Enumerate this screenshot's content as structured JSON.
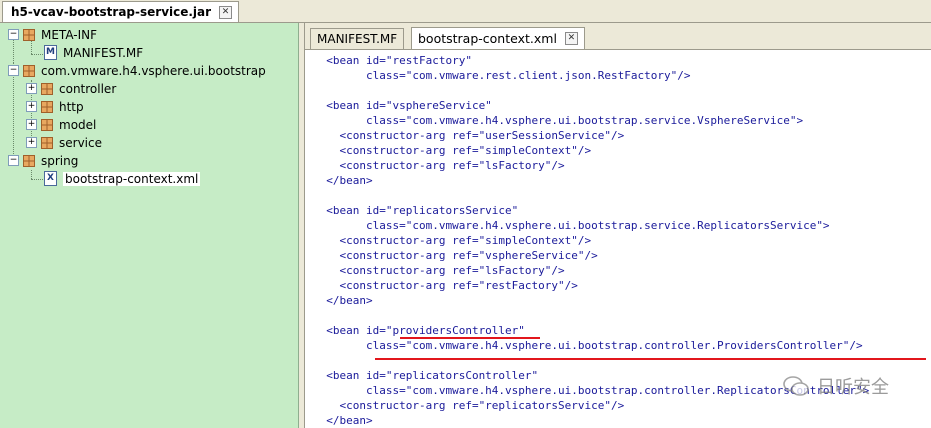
{
  "window": {
    "jar_tab_label": "h5-vcav-bootstrap-service.jar"
  },
  "tree": {
    "items": [
      {
        "label": "META-INF",
        "icon": "package-icon",
        "expander": "-"
      },
      {
        "label": "MANIFEST.MF",
        "icon": "manifest-file-icon",
        "icon_text": "M"
      },
      {
        "label": "com.vmware.h4.vsphere.ui.bootstrap",
        "icon": "package-icon",
        "expander": "-"
      },
      {
        "label": "controller",
        "icon": "package-icon",
        "expander": "+"
      },
      {
        "label": "http",
        "icon": "package-icon",
        "expander": "+"
      },
      {
        "label": "model",
        "icon": "package-icon",
        "expander": "+"
      },
      {
        "label": "service",
        "icon": "package-icon",
        "expander": "+"
      },
      {
        "label": "spring",
        "icon": "package-icon",
        "expander": "-"
      },
      {
        "label": "bootstrap-context.xml",
        "icon": "xml-file-icon",
        "icon_text": "X",
        "selected": true
      }
    ]
  },
  "editor": {
    "tabs": [
      {
        "label": "MANIFEST.MF",
        "active": false
      },
      {
        "label": "bootstrap-context.xml",
        "active": true
      }
    ],
    "lines": [
      "  <bean id=\"restFactory\"",
      "        class=\"com.vmware.rest.client.json.RestFactory\"/>",
      "",
      "  <bean id=\"vsphereService\"",
      "        class=\"com.vmware.h4.vsphere.ui.bootstrap.service.VsphereService\">",
      "    <constructor-arg ref=\"userSessionService\"/>",
      "    <constructor-arg ref=\"simpleContext\"/>",
      "    <constructor-arg ref=\"lsFactory\"/>",
      "  </bean>",
      "",
      "  <bean id=\"replicatorsService\"",
      "        class=\"com.vmware.h4.vsphere.ui.bootstrap.service.ReplicatorsService\">",
      "    <constructor-arg ref=\"simpleContext\"/>",
      "    <constructor-arg ref=\"vsphereService\"/>",
      "    <constructor-arg ref=\"lsFactory\"/>",
      "    <constructor-arg ref=\"restFactory\"/>",
      "  </bean>",
      "",
      "  <bean id=\"providersController\"",
      "        class=\"com.vmware.h4.vsphere.ui.bootstrap.controller.ProvidersController\"/>",
      "",
      "  <bean id=\"replicatorsController\"",
      "        class=\"com.vmware.h4.vsphere.ui.bootstrap.controller.ReplicatorsController\">",
      "    <constructor-arg ref=\"replicatorsService\"/>",
      "  </bean>"
    ]
  },
  "watermark": {
    "text": "日听安全"
  },
  "colors": {
    "tree_bg": "#c6ecc6",
    "code_text": "#1a1a9a",
    "annotation": "#e2161c"
  }
}
